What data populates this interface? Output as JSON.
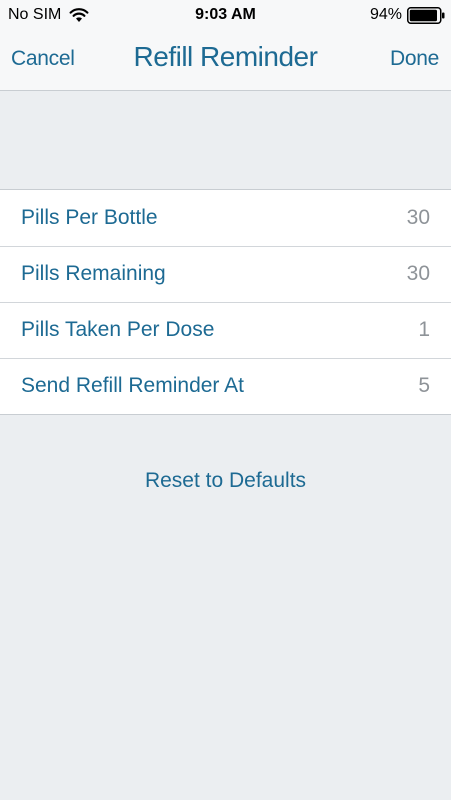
{
  "status_bar": {
    "carrier": "No SIM",
    "time": "9:03 AM",
    "battery_percent": "94%",
    "battery_level": 0.94,
    "wifi_icon": "wifi-icon",
    "battery_icon": "battery-icon"
  },
  "nav": {
    "cancel_label": "Cancel",
    "title": "Refill Reminder",
    "done_label": "Done"
  },
  "settings": {
    "rows": [
      {
        "label": "Pills Per Bottle",
        "value": "30"
      },
      {
        "label": "Pills Remaining",
        "value": "30"
      },
      {
        "label": "Pills Taken Per Dose",
        "value": "1"
      },
      {
        "label": "Send Refill Reminder At",
        "value": "5"
      }
    ]
  },
  "actions": {
    "reset_label": "Reset to Defaults"
  },
  "colors": {
    "accent": "#1d6a93",
    "value_text": "#8e9398",
    "background": "#ebeef1",
    "bar_background": "#f7f8f9"
  }
}
